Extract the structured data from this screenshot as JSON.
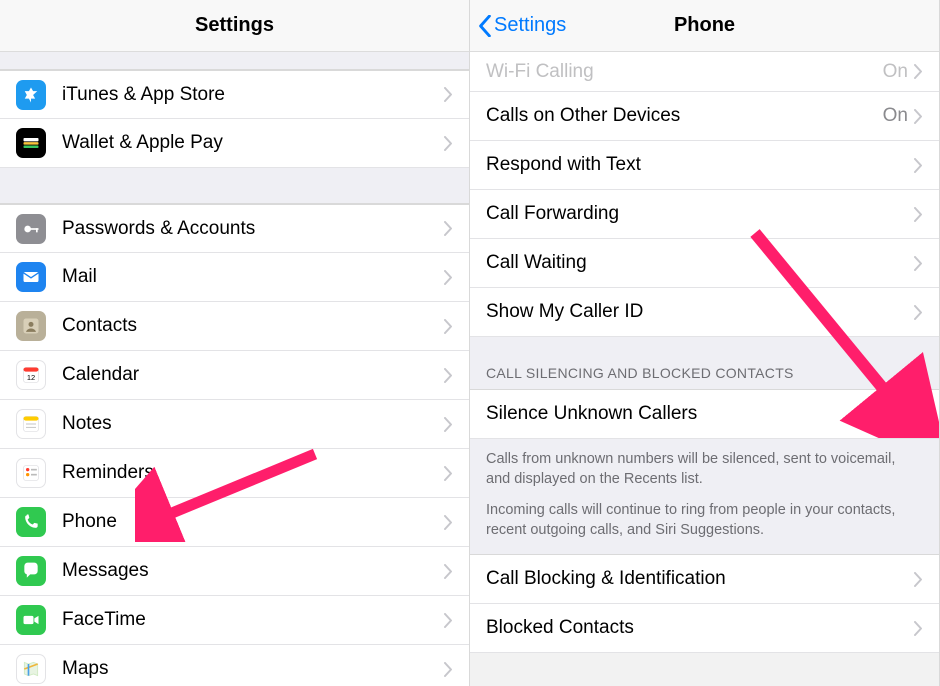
{
  "left": {
    "title": "Settings",
    "groups": [
      [
        {
          "key": "itunes",
          "label": "iTunes & App Store"
        },
        {
          "key": "wallet",
          "label": "Wallet & Apple Pay"
        }
      ],
      [
        {
          "key": "passwords",
          "label": "Passwords & Accounts"
        },
        {
          "key": "mail",
          "label": "Mail"
        },
        {
          "key": "contacts",
          "label": "Contacts"
        },
        {
          "key": "calendar",
          "label": "Calendar"
        },
        {
          "key": "notes",
          "label": "Notes"
        },
        {
          "key": "reminders",
          "label": "Reminders"
        },
        {
          "key": "phone",
          "label": "Phone"
        },
        {
          "key": "messages",
          "label": "Messages"
        },
        {
          "key": "facetime",
          "label": "FaceTime"
        },
        {
          "key": "maps",
          "label": "Maps"
        }
      ]
    ]
  },
  "right": {
    "back": "Settings",
    "title": "Phone",
    "rows_top": [
      {
        "key": "wifi-calling",
        "label": "Wi-Fi Calling",
        "value": "On"
      },
      {
        "key": "other-devices",
        "label": "Calls on Other Devices",
        "value": "On"
      },
      {
        "key": "respond-text",
        "label": "Respond with Text"
      },
      {
        "key": "call-forwarding",
        "label": "Call Forwarding"
      },
      {
        "key": "call-waiting",
        "label": "Call Waiting"
      },
      {
        "key": "caller-id",
        "label": "Show My Caller ID"
      }
    ],
    "silencing_header": "CALL SILENCING AND BLOCKED CONTACTS",
    "silence_row": {
      "label": "Silence Unknown Callers"
    },
    "footer_p1": "Calls from unknown numbers will be silenced, sent to voicemail, and displayed on the Recents list.",
    "footer_p2": "Incoming calls will continue to ring from people in your contacts, recent outgoing calls, and Siri Suggestions.",
    "rows_bottom": [
      {
        "key": "call-blocking",
        "label": "Call Blocking & Identification"
      },
      {
        "key": "blocked-contacts",
        "label": "Blocked Contacts"
      }
    ]
  },
  "icons": {
    "itunes": {
      "bg": "#1e9bf0",
      "svg": "appstore"
    },
    "wallet": {
      "bg": "#000000",
      "svg": "wallet"
    },
    "passwords": {
      "bg": "#8e8e93",
      "svg": "key"
    },
    "mail": {
      "bg": "#1e84f0",
      "svg": "mail"
    },
    "contacts": {
      "bg": "#b9b099",
      "svg": "contacts"
    },
    "calendar": {
      "bg": "#ffffff",
      "svg": "calendar"
    },
    "notes": {
      "bg": "#ffffff",
      "svg": "notes"
    },
    "reminders": {
      "bg": "#ffffff",
      "svg": "reminders"
    },
    "phone": {
      "bg": "#30c950",
      "svg": "phone"
    },
    "messages": {
      "bg": "#30c950",
      "svg": "messages"
    },
    "facetime": {
      "bg": "#30c950",
      "svg": "facetime"
    },
    "maps": {
      "bg": "#ffffff",
      "svg": "maps"
    }
  }
}
